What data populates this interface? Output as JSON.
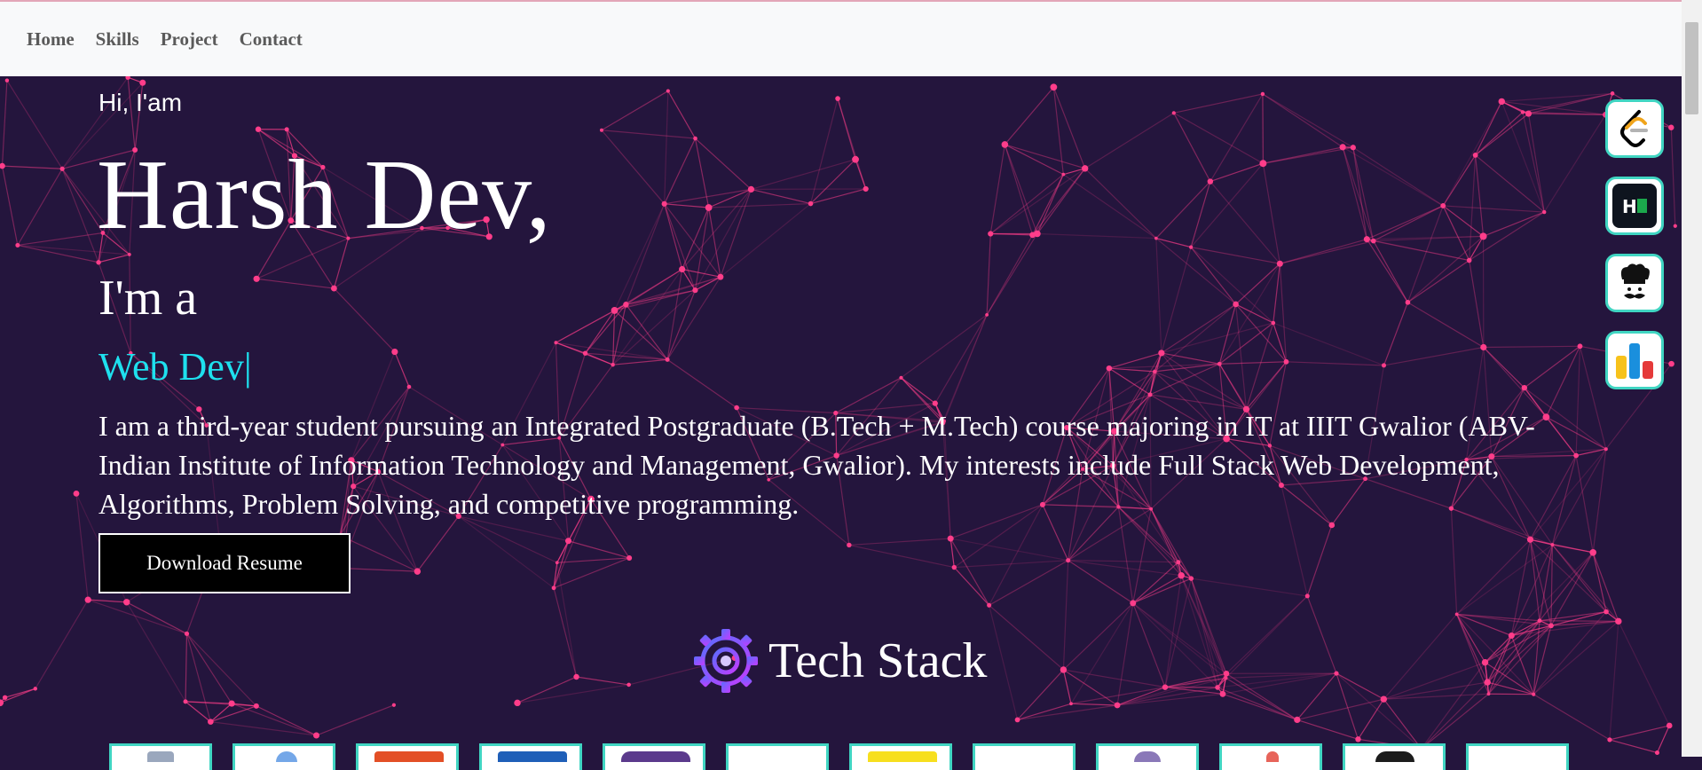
{
  "nav": {
    "links": [
      "Home",
      "Skills",
      "Project",
      "Contact"
    ]
  },
  "hero": {
    "greeting": "Hi, I'am",
    "name": "Harsh Dev,",
    "ima": "I'm a",
    "role": "Web Dev",
    "cursor": "|",
    "intro": "I am a third-year student pursuing an Integrated Postgraduate (B.Tech + M.Tech) course majoring in IT at IIIT Gwalior (ABV-Indian Institute of Information Technology and Management, Gwalior). My interests include Full Stack Web Development, Algorithms, Problem Solving, and competitive programming.",
    "button": "Download  Resume"
  },
  "tech": {
    "title": "Tech Stack",
    "icon": "gear-brain-icon"
  },
  "profiles": [
    {
      "icon": "leetcode-icon"
    },
    {
      "icon": "hackerrank-icon",
      "text": "H"
    },
    {
      "icon": "codechef-icon"
    },
    {
      "icon": "codeforces-icon"
    }
  ],
  "colors": {
    "background": "#24153d",
    "network": "#ff3d8a",
    "accent": "#1ee0ee",
    "icon_border": "#40d5c2"
  }
}
